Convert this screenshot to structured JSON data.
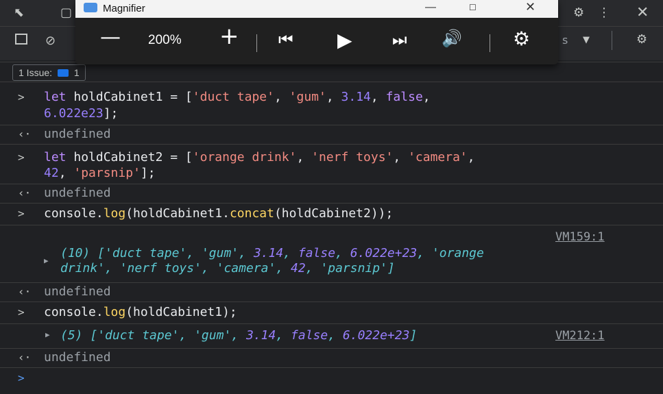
{
  "devtools": {
    "issues_label": "1 Issue:",
    "issues_count": "1",
    "filter_partial": "s"
  },
  "magnifier": {
    "title": "Magnifier",
    "zoom": "200%",
    "icons": [
      "minus-icon",
      "plus-icon",
      "skip-back-icon",
      "play-icon",
      "skip-forward-icon",
      "read-aloud-icon",
      "gear-icon"
    ]
  },
  "console": {
    "input1": {
      "prefix": ">",
      "l1": [
        "let ",
        "holdCabinet1",
        " = [",
        "'duct tape'",
        ", ",
        "'gum'",
        ", ",
        "3.14",
        ", ",
        "false",
        ","
      ],
      "l2": [
        "6.022e23",
        "];"
      ]
    },
    "undef": "undefined",
    "input2": {
      "l1": [
        "let ",
        "holdCabinet2",
        " = [",
        "'orange drink'",
        ", ",
        "'nerf toys'",
        ", ",
        "'camera'",
        ","
      ],
      "l2": [
        "42",
        ", ",
        "'parsnip'",
        "];"
      ]
    },
    "input3": [
      "console.",
      "log",
      "(holdCabinet1.",
      "concat",
      "(holdCabinet2));"
    ],
    "output3": {
      "source": "VM159:1",
      "l1": [
        "(10) [",
        "'duct tape'",
        ", ",
        "'gum'",
        ", ",
        "3.14",
        ", ",
        "false",
        ", ",
        "6.022e+23",
        ", ",
        "'orange"
      ],
      "l2": [
        "drink'",
        ", ",
        "'nerf toys'",
        ", ",
        "'camera'",
        ", ",
        "42",
        ", ",
        "'parsnip'",
        "]"
      ]
    },
    "input4": [
      "console.",
      "log",
      "(holdCabinet1);"
    ],
    "output4": {
      "source": "VM212:1",
      "l1": [
        "(5) [",
        "'duct tape'",
        ", ",
        "'gum'",
        ", ",
        "3.14",
        ", ",
        "false",
        ", ",
        "6.022e+23",
        "]"
      ]
    },
    "prompt": ">"
  }
}
